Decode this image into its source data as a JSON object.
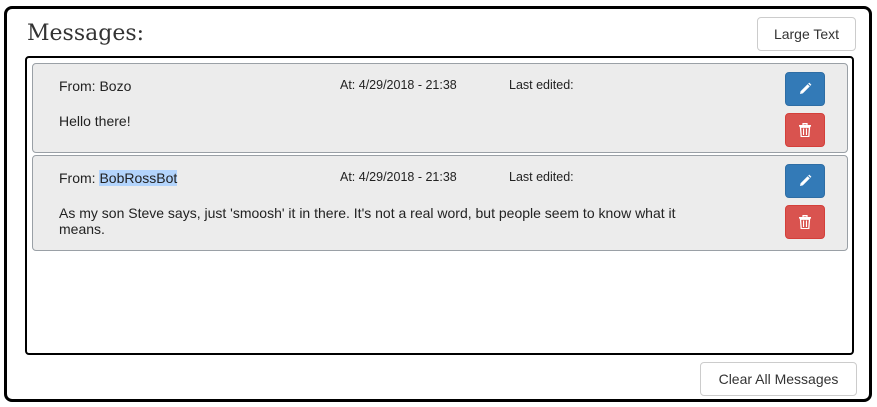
{
  "header": {
    "title": "Messages:",
    "large_text_label": "Large Text"
  },
  "messages": [
    {
      "from_label": "From: ",
      "from_name": "Bozo",
      "at": "At: 4/29/2018 - 21:38",
      "last_edited": "Last edited:",
      "body": "Hello there!",
      "name_selected": false
    },
    {
      "from_label": "From: ",
      "from_name": "BobRossBot",
      "at": "At: 4/29/2018 - 21:38",
      "last_edited": "Last edited:",
      "body": "As my son Steve says, just 'smoosh' it in there. It's not a real word, but people seem to know what it means.",
      "name_selected": true
    }
  ],
  "footer": {
    "clear_all_label": "Clear All Messages"
  },
  "icons": {
    "edit": "pencil-icon",
    "delete": "trash-icon"
  },
  "colors": {
    "edit_button": "#337ab7",
    "delete_button": "#d9534f",
    "selection": "#b3d4fc"
  }
}
